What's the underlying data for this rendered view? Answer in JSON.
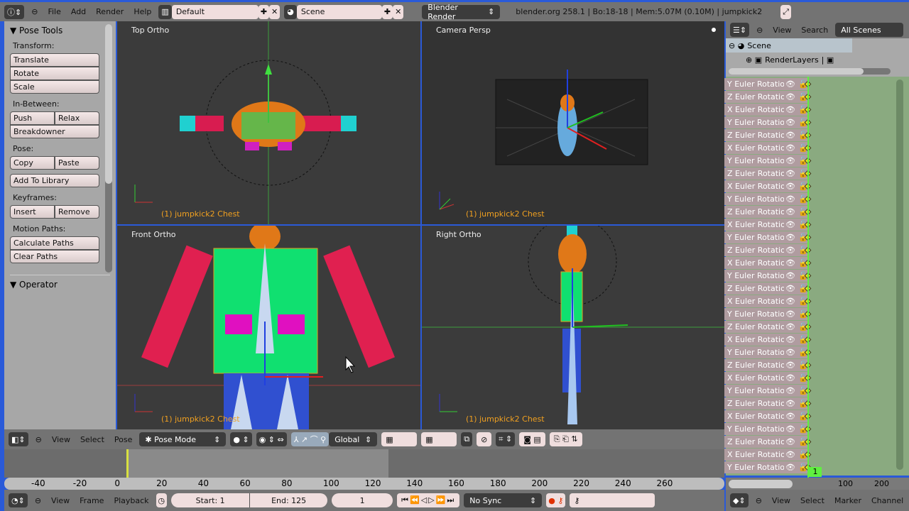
{
  "topbar": {
    "menus": [
      "File",
      "Add",
      "Render",
      "Help"
    ],
    "layout": "Default",
    "scene": "Scene",
    "engine": "Blender Render",
    "info": "blender.org 258.1 | Bo:18-18  | Mem:5.07M (0.10M) | jumpkick2"
  },
  "tools": {
    "title": "Pose Tools",
    "transform_label": "Transform:",
    "translate": "Translate",
    "rotate": "Rotate",
    "scale": "Scale",
    "inbetween_label": "In-Between:",
    "push": "Push",
    "relax": "Relax",
    "breakdowner": "Breakdowner",
    "pose_label": "Pose:",
    "copy": "Copy",
    "paste": "Paste",
    "add_library": "Add To Library",
    "keyframes_label": "Keyframes:",
    "insert": "Insert",
    "remove": "Remove",
    "motion_label": "Motion Paths:",
    "calc": "Calculate Paths",
    "clear": "Clear Paths",
    "operator": "Operator"
  },
  "viewports": {
    "top": "Top Ortho",
    "camera": "Camera Persp",
    "front": "Front Ortho",
    "right": "Right Ortho",
    "info": "(1) jumpkick2 Chest"
  },
  "view3d_header": {
    "view": "View",
    "select": "Select",
    "pose": "Pose",
    "mode": "Pose Mode",
    "orientation": "Global"
  },
  "timeline": {
    "ticks": [
      "-40",
      "-20",
      "0",
      "20",
      "40",
      "60",
      "80",
      "100",
      "120",
      "140",
      "160",
      "180",
      "200",
      "220",
      "240",
      "260"
    ],
    "view": "View",
    "frame": "Frame",
    "playback": "Playback",
    "start": "Start: 1",
    "end": "End: 125",
    "current": "1",
    "sync": "No Sync"
  },
  "outliner": {
    "view": "View",
    "search": "Search",
    "filter": "All Scenes",
    "scene": "Scene",
    "renderlayers": "RenderLayers"
  },
  "dopesheet": {
    "channels": [
      "Y Euler Rotatio",
      "Z Euler Rotatio",
      "X Euler Rotatio",
      "Y Euler Rotatio",
      "Z Euler Rotatio",
      "X Euler Rotatio",
      "Y Euler Rotatio",
      "Z Euler Rotatio",
      "X Euler Rotatio",
      "Y Euler Rotatio",
      "Z Euler Rotatio",
      "X Euler Rotatio",
      "Y Euler Rotatio",
      "Z Euler Rotatio",
      "X Euler Rotatio",
      "Y Euler Rotatio",
      "Z Euler Rotatio",
      "X Euler Rotatio",
      "Y Euler Rotatio",
      "Z Euler Rotatio",
      "X Euler Rotatio",
      "Y Euler Rotatio",
      "Z Euler Rotatio",
      "X Euler Rotatio",
      "Y Euler Rotatio",
      "Z Euler Rotatio",
      "X Euler Rotatio",
      "Y Euler Rotatio",
      "Z Euler Rotatio",
      "X Euler Rotatio",
      "Y Euler Rotatio"
    ],
    "frame": "1",
    "ticks": [
      "100",
      "200"
    ],
    "view": "View",
    "select": "Select",
    "marker": "Marker",
    "channel": "Channel"
  }
}
